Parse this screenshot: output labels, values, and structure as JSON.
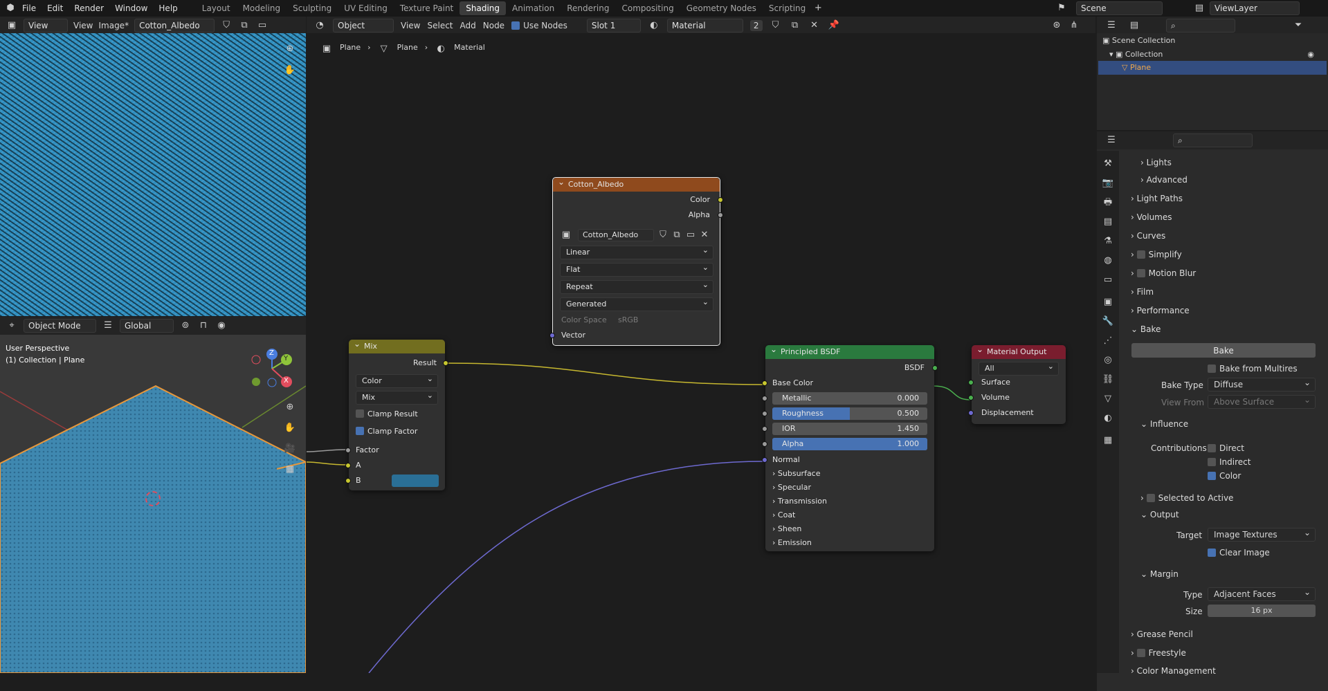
{
  "topbar": {
    "menus": [
      "File",
      "Edit",
      "Render",
      "Window",
      "Help"
    ],
    "workspaces": [
      "Layout",
      "Modeling",
      "Sculpting",
      "UV Editing",
      "Texture Paint",
      "Shading",
      "Animation",
      "Rendering",
      "Compositing",
      "Geometry Nodes",
      "Scripting"
    ],
    "active_workspace": "Shading",
    "scene": "Scene",
    "view_layer": "ViewLayer"
  },
  "image_editor": {
    "view": "View",
    "view2": "View",
    "image_menu": "Image*",
    "image_name": "Cotton_Albedo"
  },
  "viewport": {
    "mode": "Object Mode",
    "orientation": "Global",
    "perspective": "User Perspective",
    "collection_info": "(1) Collection | Plane",
    "axes": [
      "Z",
      "Y",
      "X"
    ]
  },
  "node_editor": {
    "object_mode": "Object",
    "menus": [
      "View",
      "Select",
      "Add",
      "Node"
    ],
    "use_nodes": "Use Nodes",
    "slot": "Slot 1",
    "material": "Material",
    "users": "2",
    "breadcrumb": [
      "Plane",
      "Plane",
      "Material"
    ]
  },
  "nodes": {
    "image": {
      "title": "Cotton_Albedo",
      "outputs": [
        "Color",
        "Alpha"
      ],
      "image": "Cotton_Albedo",
      "interpolation": "Linear",
      "projection": "Flat",
      "extension": "Repeat",
      "source": "Generated",
      "color_space_label": "Color Space",
      "color_space": "sRGB",
      "input": "Vector"
    },
    "mix": {
      "title": "Mix",
      "output": "Result",
      "data_type": "Color",
      "blend": "Mix",
      "clamp_result": "Clamp Result",
      "clamp_factor": "Clamp Factor",
      "inputs": [
        "Factor",
        "A",
        "B"
      ],
      "b_color": "#2a6f96"
    },
    "bsdf": {
      "title": "Principled BSDF",
      "output": "BSDF",
      "base_color": "Base Color",
      "metallic": {
        "label": "Metallic",
        "value": "0.000",
        "fraction": 0
      },
      "roughness": {
        "label": "Roughness",
        "value": "0.500",
        "fraction": 0.5
      },
      "ior": {
        "label": "IOR",
        "value": "1.450",
        "fraction": 0
      },
      "alpha": {
        "label": "Alpha",
        "value": "1.000",
        "fraction": 1
      },
      "normal": "Normal",
      "panels": [
        "Subsurface",
        "Specular",
        "Transmission",
        "Coat",
        "Sheen",
        "Emission"
      ]
    },
    "output": {
      "title": "Material Output",
      "target": "All",
      "inputs": [
        "Surface",
        "Volume",
        "Displacement"
      ]
    }
  },
  "outliner": {
    "scene_collection": "Scene Collection",
    "collection": "Collection",
    "object": "Plane"
  },
  "properties": {
    "lights": "Lights",
    "advanced": "Advanced",
    "sections": [
      "Light Paths",
      "Volumes",
      "Curves",
      "Simplify",
      "Motion Blur",
      "Film",
      "Performance",
      "Bake"
    ],
    "bake_button": "Bake",
    "bake_from_multires": "Bake from Multires",
    "bake_type_label": "Bake Type",
    "bake_type": "Diffuse",
    "view_from_label": "View From",
    "view_from": "Above Surface",
    "influence": "Influence",
    "contributions": "Contributions",
    "direct": "Direct",
    "indirect": "Indirect",
    "color": "Color",
    "selected_to_active": "Selected to Active",
    "output": "Output",
    "target_label": "Target",
    "target": "Image Textures",
    "clear_image": "Clear Image",
    "margin": "Margin",
    "type_label": "Type",
    "type": "Adjacent Faces",
    "size_label": "Size",
    "size": "16 px",
    "grease_pencil": "Grease Pencil",
    "freestyle": "Freestyle",
    "color_management": "Color Management"
  }
}
